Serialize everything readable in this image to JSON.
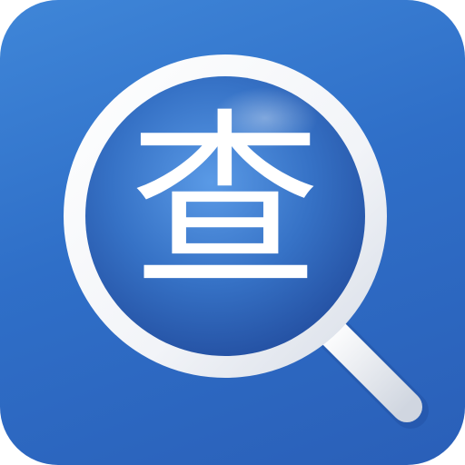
{
  "icon": {
    "glyph": "查",
    "colors": {
      "background_light": "#3f86d8",
      "background_dark": "#2a5fb8",
      "lens_center": "#4f8fe0",
      "lens_edge": "#2554a8",
      "ring": "#ffffff",
      "glyph": "#ffffff"
    },
    "symbol": "magnifier-icon"
  }
}
